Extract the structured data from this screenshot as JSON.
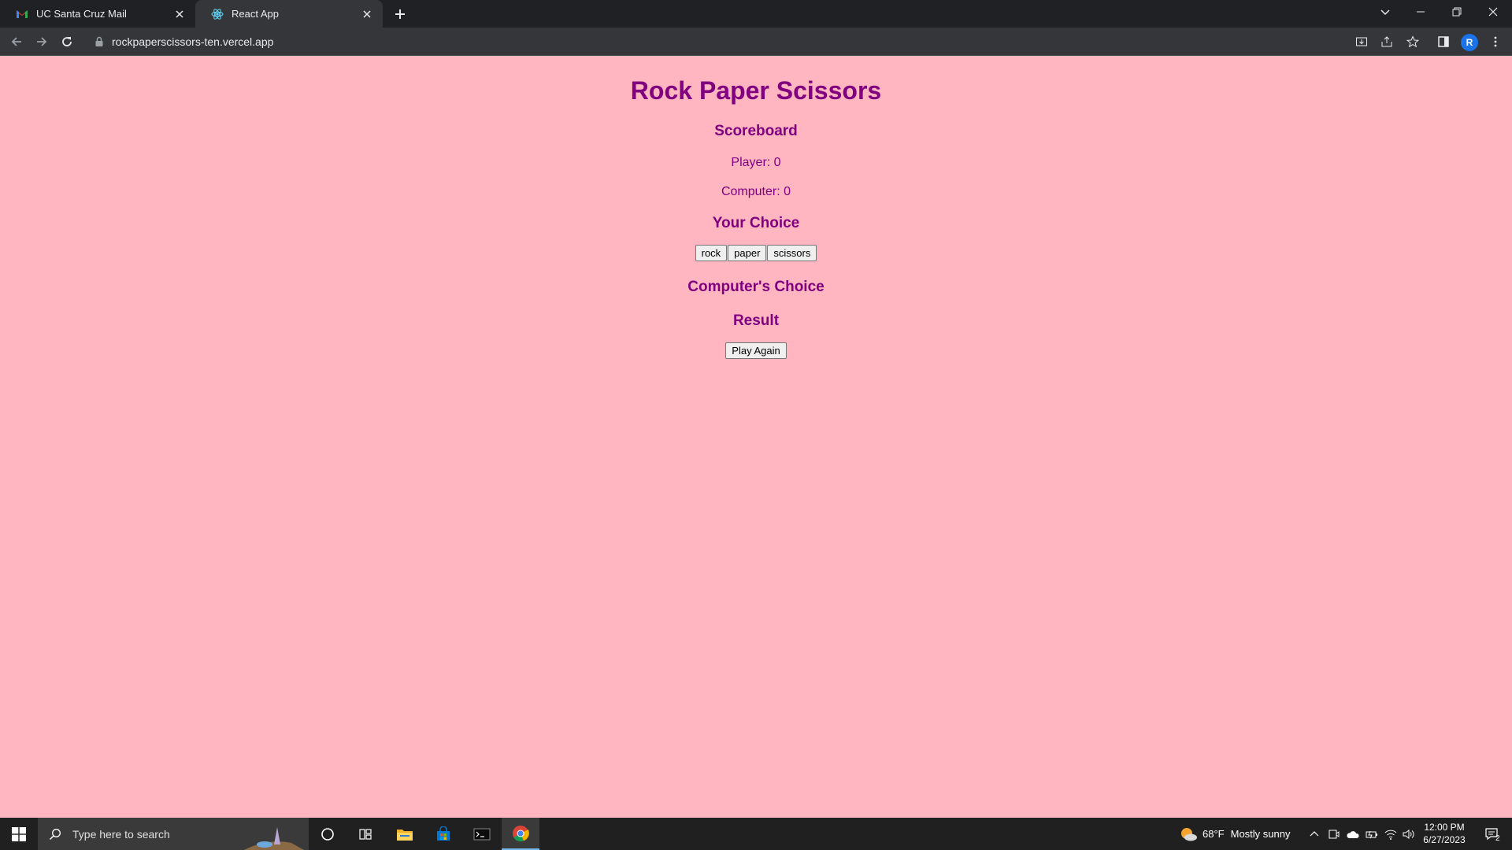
{
  "browser": {
    "tabs": [
      {
        "label": "UC Santa Cruz Mail",
        "icon": "gmail-icon",
        "active": false
      },
      {
        "label": "React App",
        "icon": "react-icon",
        "active": true
      }
    ],
    "url": "rockpaperscissors-ten.vercel.app",
    "profile_initial": "R"
  },
  "app": {
    "title": "Rock Paper Scissors",
    "scoreboard_heading": "Scoreboard",
    "player_score": "Player: 0",
    "computer_score": "Computer: 0",
    "your_choice_heading": "Your Choice",
    "choices": [
      "rock",
      "paper",
      "scissors"
    ],
    "computer_choice_heading": "Computer's Choice",
    "result_heading": "Result",
    "play_again_label": "Play Again",
    "colors": {
      "background": "#ffb6c1",
      "text": "#800080"
    }
  },
  "taskbar": {
    "search_placeholder": "Type here to search",
    "weather_temp": "68°F",
    "weather_desc": "Mostly sunny",
    "time": "12:00 PM",
    "date": "6/27/2023",
    "notification_count": "2"
  }
}
